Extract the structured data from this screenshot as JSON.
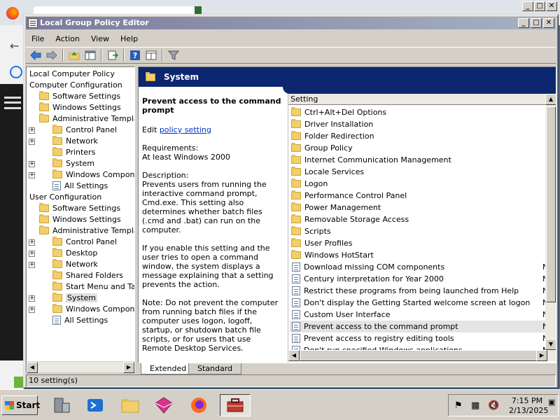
{
  "window": {
    "title": "Local Group Policy Editor",
    "minimize": "_",
    "maximize": "□",
    "close": "✕"
  },
  "menu": [
    "File",
    "Action",
    "View",
    "Help"
  ],
  "tree": [
    {
      "label": "Local Computer Policy"
    },
    {
      "label": "Computer Configuration"
    },
    {
      "label": "Software Settings"
    },
    {
      "label": "Windows Settings"
    },
    {
      "label": "Administrative Templates"
    },
    {
      "label": "Control Panel",
      "expander": "+"
    },
    {
      "label": "Network",
      "expander": "+"
    },
    {
      "label": "Printers"
    },
    {
      "label": "System",
      "expander": "+"
    },
    {
      "label": "Windows Components",
      "expander": "+"
    },
    {
      "label": "All Settings"
    },
    {
      "label": "User Configuration"
    },
    {
      "label": "Software Settings"
    },
    {
      "label": "Windows Settings"
    },
    {
      "label": "Administrative Templates"
    },
    {
      "label": "Control Panel",
      "expander": "+"
    },
    {
      "label": "Desktop",
      "expander": "+"
    },
    {
      "label": "Network",
      "expander": "+"
    },
    {
      "label": "Shared Folders"
    },
    {
      "label": "Start Menu and Taskbar"
    },
    {
      "label": "System",
      "expander": "+"
    },
    {
      "label": "Windows Components",
      "expander": "+"
    },
    {
      "label": "All Settings"
    }
  ],
  "right": {
    "banner": "System",
    "description": {
      "title": "Prevent access to the command prompt",
      "edit_prefix": "Edit",
      "edit_link": "policy setting",
      "requirements_label": "Requirements:",
      "requirements_value": "At least Windows 2000",
      "description_label": "Description:",
      "para1": "Prevents users from running the interactive command prompt, Cmd.exe. This setting also determines whether batch files (.cmd and .bat) can run on the computer.",
      "para2": "If you enable this setting and the user tries to open a command window, the system displays a message explaining that a setting prevents the action.",
      "para3": "Note: Do not prevent the computer from running batch files if the computer uses logon, logoff, startup, or shutdown batch file scripts, or for users that use Remote Desktop Services."
    },
    "list": {
      "header": "Setting",
      "state_cell": "N",
      "rows": [
        {
          "label": "Ctrl+Alt+Del Options",
          "type": "folder"
        },
        {
          "label": "Driver Installation",
          "type": "folder"
        },
        {
          "label": "Folder Redirection",
          "type": "folder"
        },
        {
          "label": "Group Policy",
          "type": "folder"
        },
        {
          "label": "Internet Communication Management",
          "type": "folder"
        },
        {
          "label": "Locale Services",
          "type": "folder"
        },
        {
          "label": "Logon",
          "type": "folder"
        },
        {
          "label": "Performance Control Panel",
          "type": "folder"
        },
        {
          "label": "Power Management",
          "type": "folder"
        },
        {
          "label": "Removable Storage Access",
          "type": "folder"
        },
        {
          "label": "Scripts",
          "type": "folder"
        },
        {
          "label": "User Profiles",
          "type": "folder"
        },
        {
          "label": "Windows HotStart",
          "type": "folder"
        },
        {
          "label": "Download missing COM components",
          "type": "setting"
        },
        {
          "label": "Century interpretation for Year 2000",
          "type": "setting"
        },
        {
          "label": "Restrict these programs from being launched from Help",
          "type": "setting"
        },
        {
          "label": "Don't display the Getting Started welcome screen at logon",
          "type": "setting"
        },
        {
          "label": "Custom User Interface",
          "type": "setting"
        },
        {
          "label": "Prevent access to the command prompt",
          "type": "setting",
          "selected": true
        },
        {
          "label": "Prevent access to registry editing tools",
          "type": "setting"
        },
        {
          "label": "Don't run specified Windows applications",
          "type": "setting"
        }
      ]
    }
  },
  "tabs": [
    "Extended",
    "Standard"
  ],
  "status": "10 setting(s)",
  "taskbar": {
    "start": "Start",
    "time": "7:15 PM",
    "date": "2/13/2025"
  }
}
